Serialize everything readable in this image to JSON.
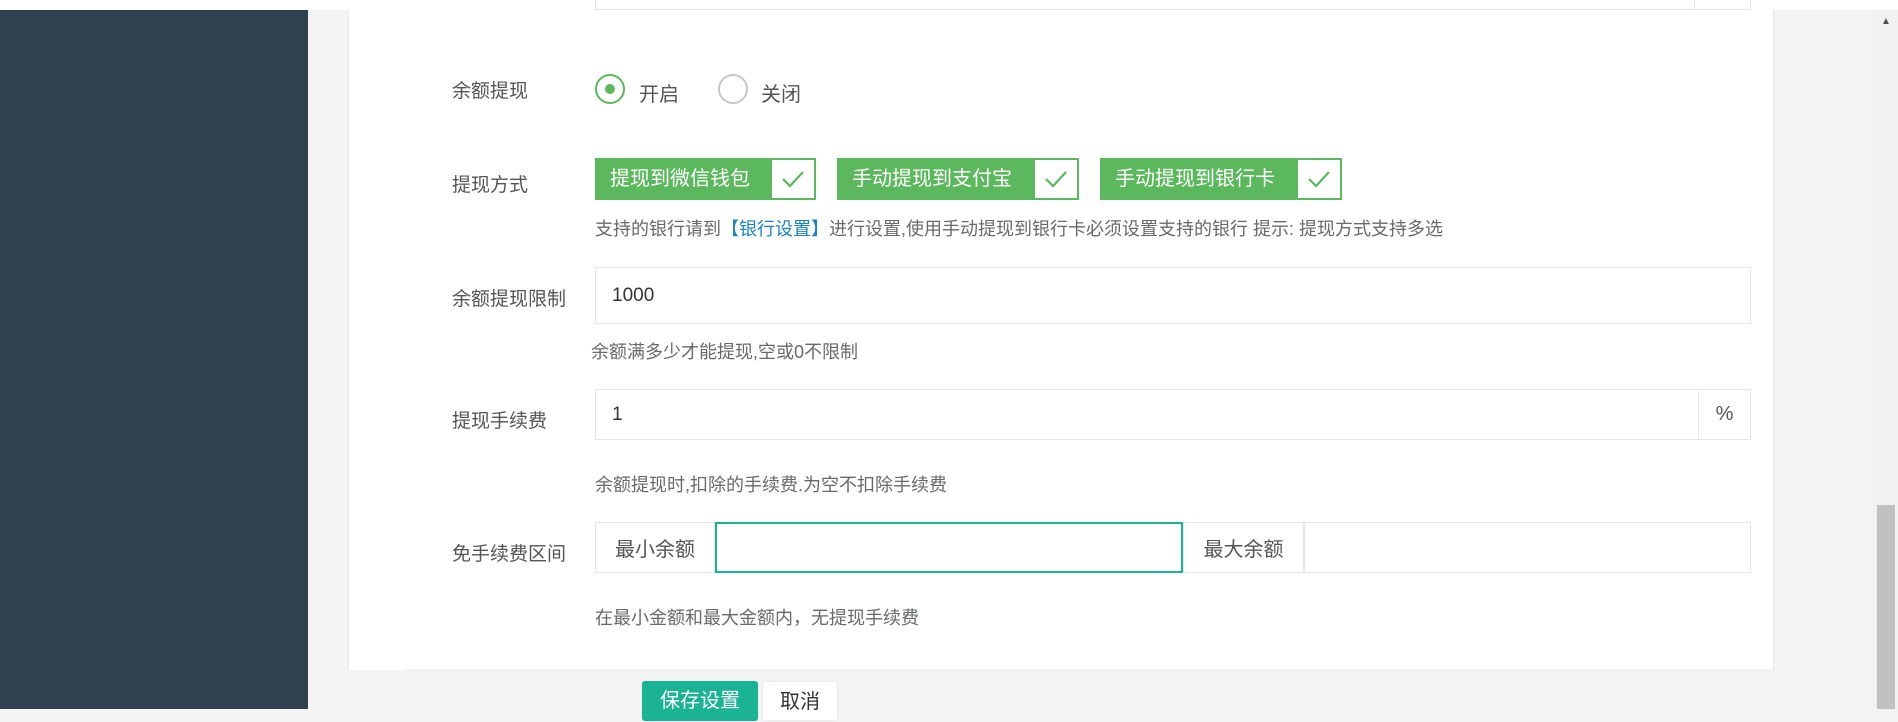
{
  "form": {
    "withdraw": {
      "label": "余额提现",
      "options": [
        "开启",
        "关闭"
      ],
      "selected": "开启"
    },
    "method": {
      "label": "提现方式",
      "tags": [
        "提现到微信钱包",
        "手动提现到支付宝",
        "手动提现到银行卡"
      ],
      "hint_prefix": "支持的银行请到",
      "hint_link": "【银行设置】",
      "hint_suffix": "进行设置,使用手动提现到银行卡必须设置支持的银行 提示: 提现方式支持多选"
    },
    "limit": {
      "label": "余额提现限制",
      "value": "1000",
      "hint": "余额满多少才能提现,空或0不限制"
    },
    "fee": {
      "label": "提现手续费",
      "value": "1",
      "unit": "%",
      "hint": "余额提现时,扣除的手续费.为空不扣除手续费"
    },
    "free_range": {
      "label": "免手续费区间",
      "min_label": "最小余额",
      "min_value": "",
      "max_label": "最大余额",
      "max_value": "",
      "hint": "在最小金额和最大金额内，无提现手续费"
    },
    "buttons": {
      "save": "保存设置",
      "cancel": "取消"
    }
  },
  "colors": {
    "sidebar": "#2f4050",
    "tag_green": "#5cb85c",
    "primary": "#1ab394",
    "link": "#1c84c6"
  }
}
